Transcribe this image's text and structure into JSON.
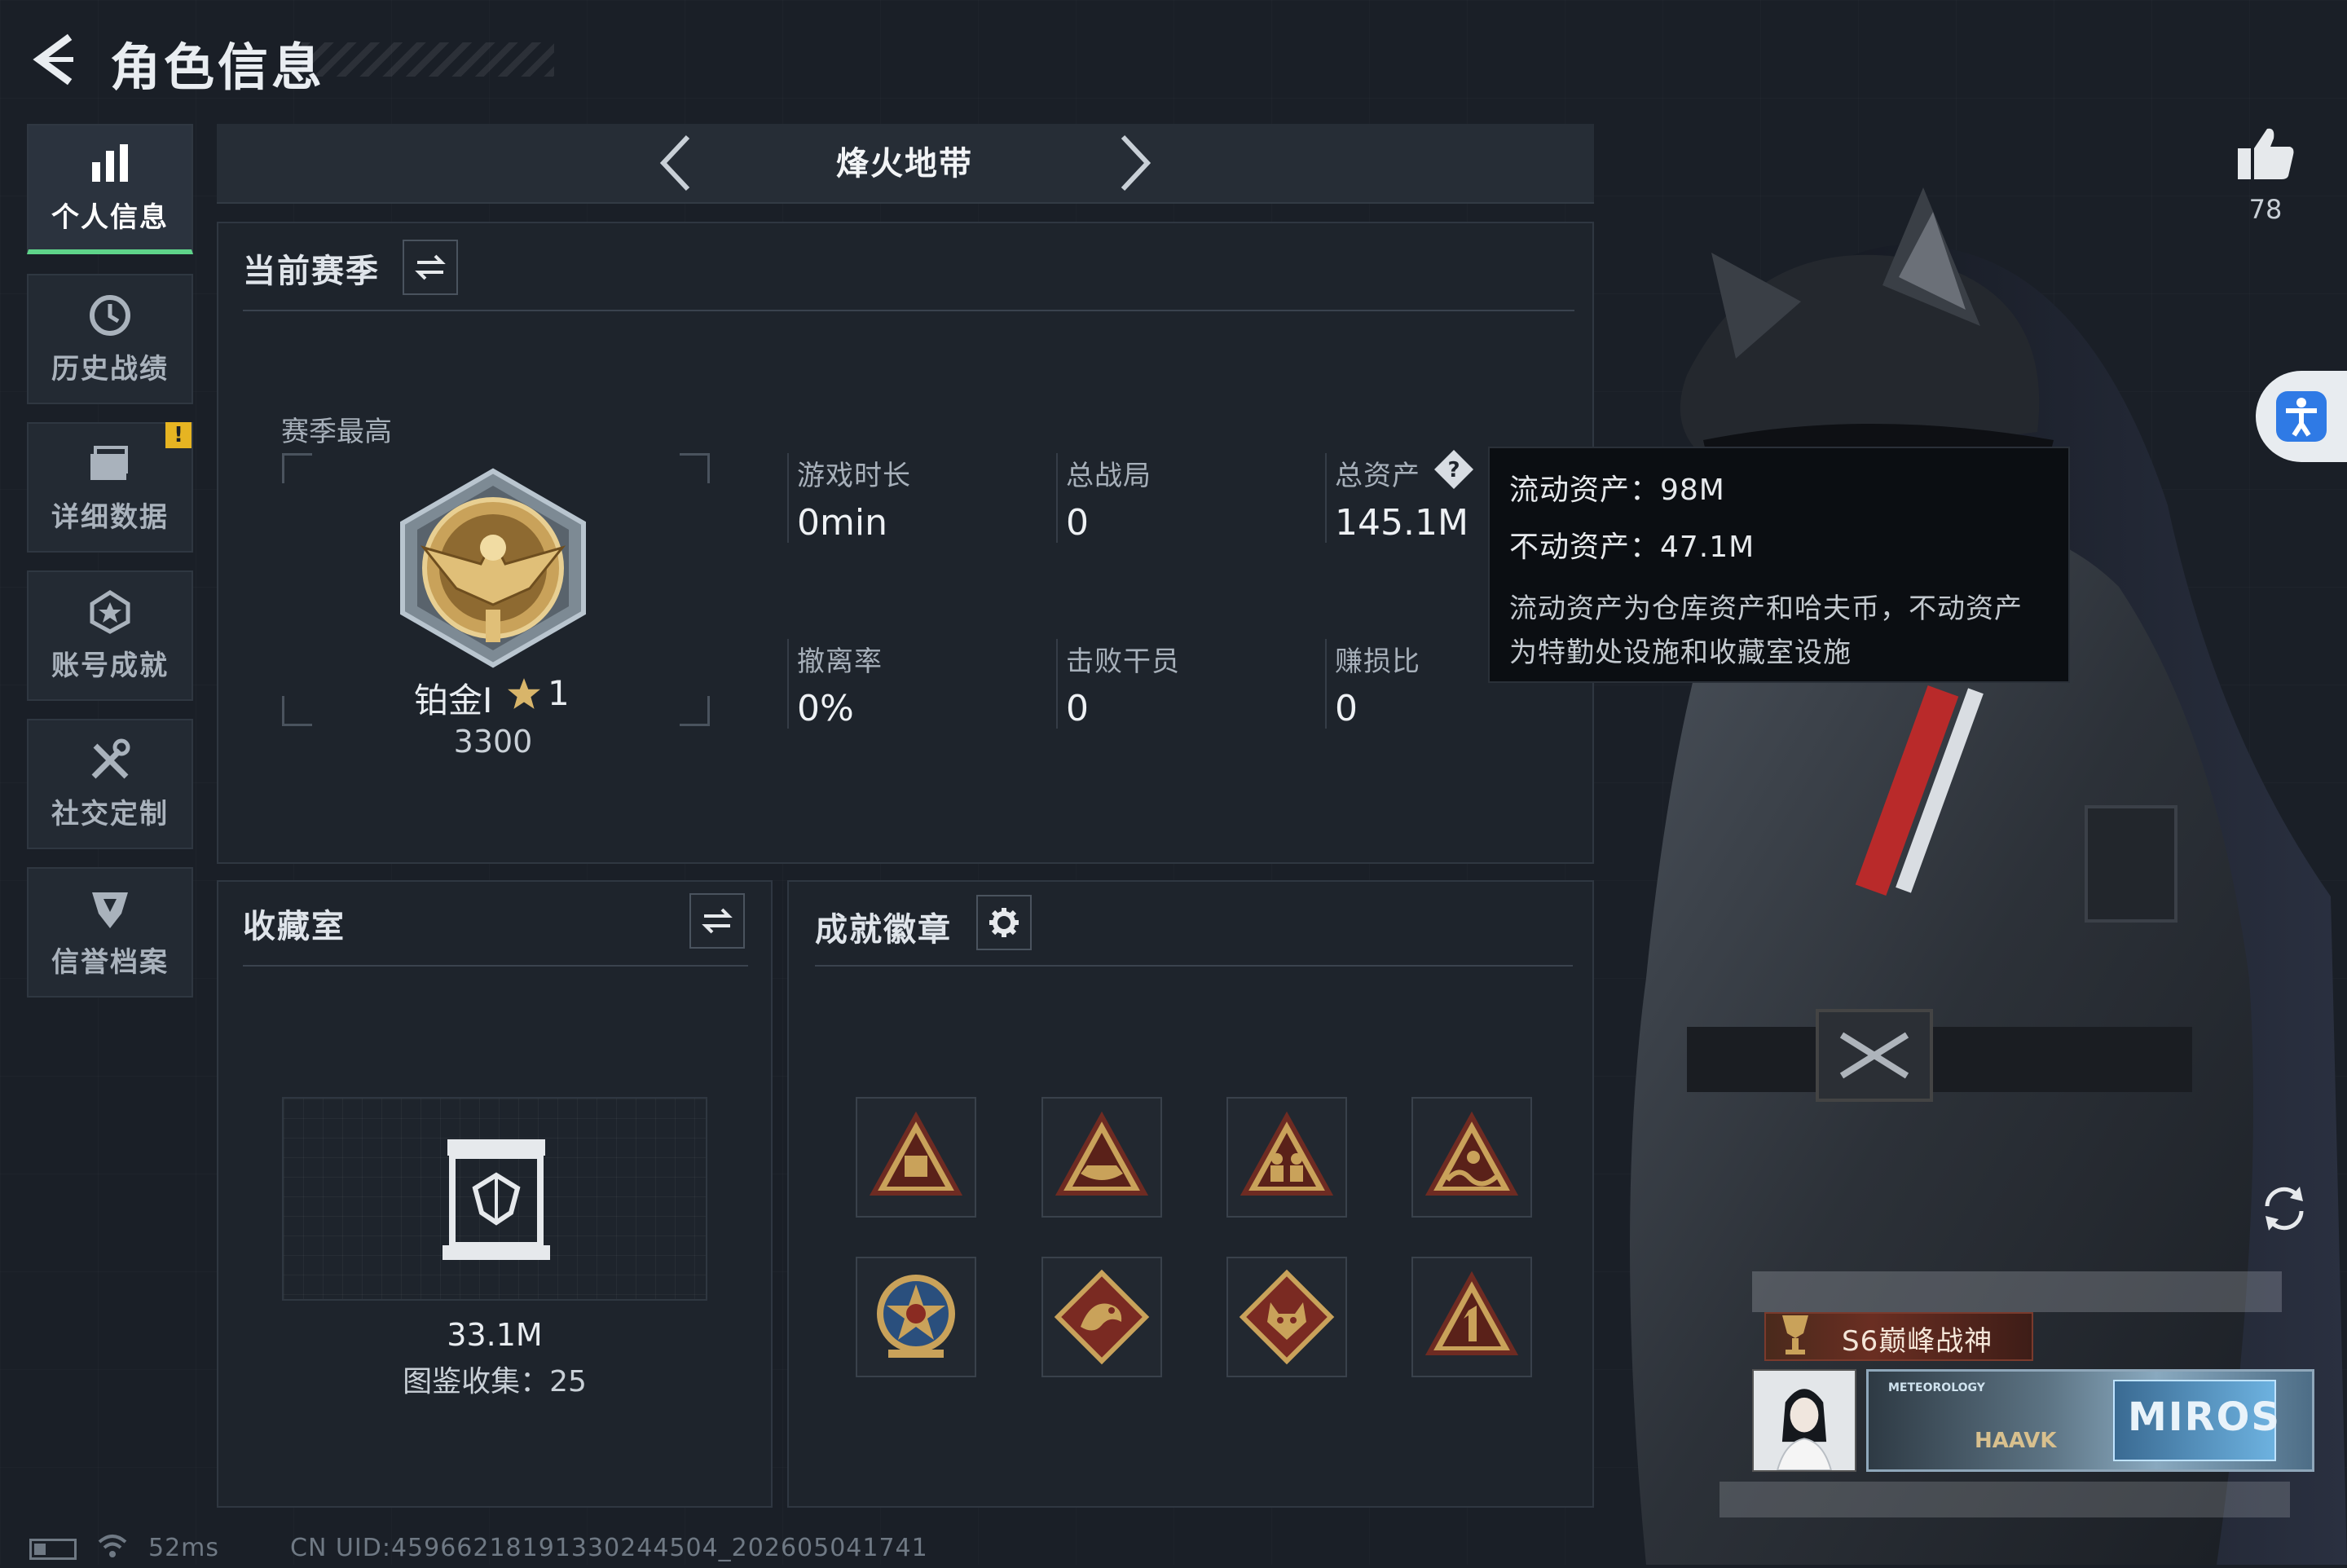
{
  "header": {
    "title": "角色信息"
  },
  "sidebar": {
    "items": [
      {
        "label": "个人信息",
        "icon": "bar-chart-icon",
        "active": true
      },
      {
        "label": "历史战绩",
        "icon": "history-clock-icon"
      },
      {
        "label": "详细数据",
        "icon": "folder-icon",
        "badge": "!"
      },
      {
        "label": "账号成就",
        "icon": "achievement-star-icon"
      },
      {
        "label": "社交定制",
        "icon": "tools-icon"
      },
      {
        "label": "信誉档案",
        "icon": "shield-icon"
      }
    ]
  },
  "mode": {
    "title": "烽火地带"
  },
  "season": {
    "header": "当前赛季",
    "best_label": "赛季最高",
    "rank_name": "铂金Ⅰ",
    "rank_stars": "1",
    "rank_points": "3300",
    "stats": [
      {
        "label": "游戏时长",
        "value": "0min"
      },
      {
        "label": "总战局",
        "value": "0"
      },
      {
        "label": "总资产",
        "value": "145.1M"
      },
      {
        "label": "撤离率",
        "value": "0%"
      },
      {
        "label": "击败干员",
        "value": "0"
      },
      {
        "label": "赚损比",
        "value": "0"
      }
    ]
  },
  "tooltip": {
    "liquid": "流动资产：98M",
    "fixed": "不动资产：47.1M",
    "desc_line1": "流动资产为仓库资产和哈夫币，不动资产",
    "desc_line2": "为特勤处设施和收藏室设施"
  },
  "collection": {
    "header": "收藏室",
    "value": "33.1M",
    "catalog": "图鉴收集：25"
  },
  "badges": {
    "header": "成就徽章",
    "items": [
      "badge-triangle-crate-icon",
      "badge-triangle-boat-icon",
      "badge-triangle-squad-icon",
      "badge-triangle-wave-icon",
      "badge-star-medal-icon",
      "badge-diamond-dragon-icon",
      "badge-diamond-wolf-icon",
      "badge-triangle-number-one-icon"
    ]
  },
  "character": {
    "likes": "78",
    "title_tag": "S6巅峰战神",
    "banner_small": "METEOROLOGY",
    "banner_name": "HAAVK",
    "banner_logo": "MIROS"
  },
  "footer": {
    "ping": "52ms",
    "uid": "CN UID:4596621819133024450​4_202605041741"
  },
  "colors": {
    "background": "#1a1f27",
    "panel": "#1e242c",
    "accent_green": "#5fd48a",
    "alert_yellow": "#e6b422",
    "badge_gold": "#c9a25a"
  }
}
